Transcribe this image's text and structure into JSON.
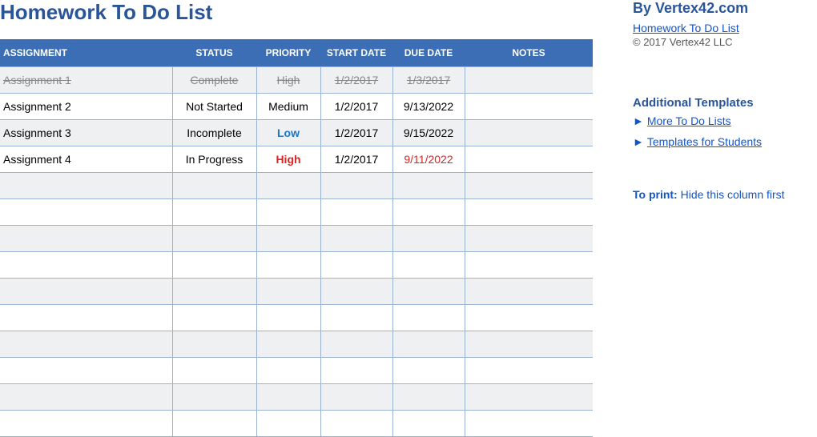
{
  "title": "Homework To Do List",
  "headers": {
    "assignment": "Assignment",
    "status": "Status",
    "priority": "Priority",
    "start_date": "Start Date",
    "due_date": "Due Date",
    "notes": "Notes"
  },
  "rows": [
    {
      "assignment": "Assignment 1",
      "status": "Complete",
      "priority": "High",
      "start": "1/2/2017",
      "due": "1/3/2017",
      "notes": "",
      "complete": true,
      "alt": true,
      "priority_style": "strike",
      "due_style": ""
    },
    {
      "assignment": "Assignment 2",
      "status": "Not Started",
      "priority": "Medium",
      "start": "1/2/2017",
      "due": "9/13/2022",
      "notes": "",
      "complete": false,
      "alt": false,
      "priority_style": "",
      "due_style": ""
    },
    {
      "assignment": "Assignment 3",
      "status": "Incomplete",
      "priority": "Low",
      "start": "1/2/2017",
      "due": "9/15/2022",
      "notes": "",
      "complete": false,
      "alt": true,
      "priority_style": "low",
      "due_style": ""
    },
    {
      "assignment": "Assignment 4",
      "status": "In Progress",
      "priority": "High",
      "start": "1/2/2017",
      "due": "9/11/2022",
      "notes": "",
      "complete": false,
      "alt": false,
      "priority_style": "high",
      "due_style": "red"
    }
  ],
  "empty_rows": 10,
  "sidebar": {
    "by_line": "By Vertex42.com",
    "template_link": "Homework To Do List",
    "copyright": "© 2017 Vertex42 LLC",
    "additional_heading": "Additional Templates",
    "link1": "More To Do Lists",
    "link2": "Templates for Students",
    "arrow": "►",
    "print_label": "To print:",
    "print_text": " Hide this column first"
  }
}
